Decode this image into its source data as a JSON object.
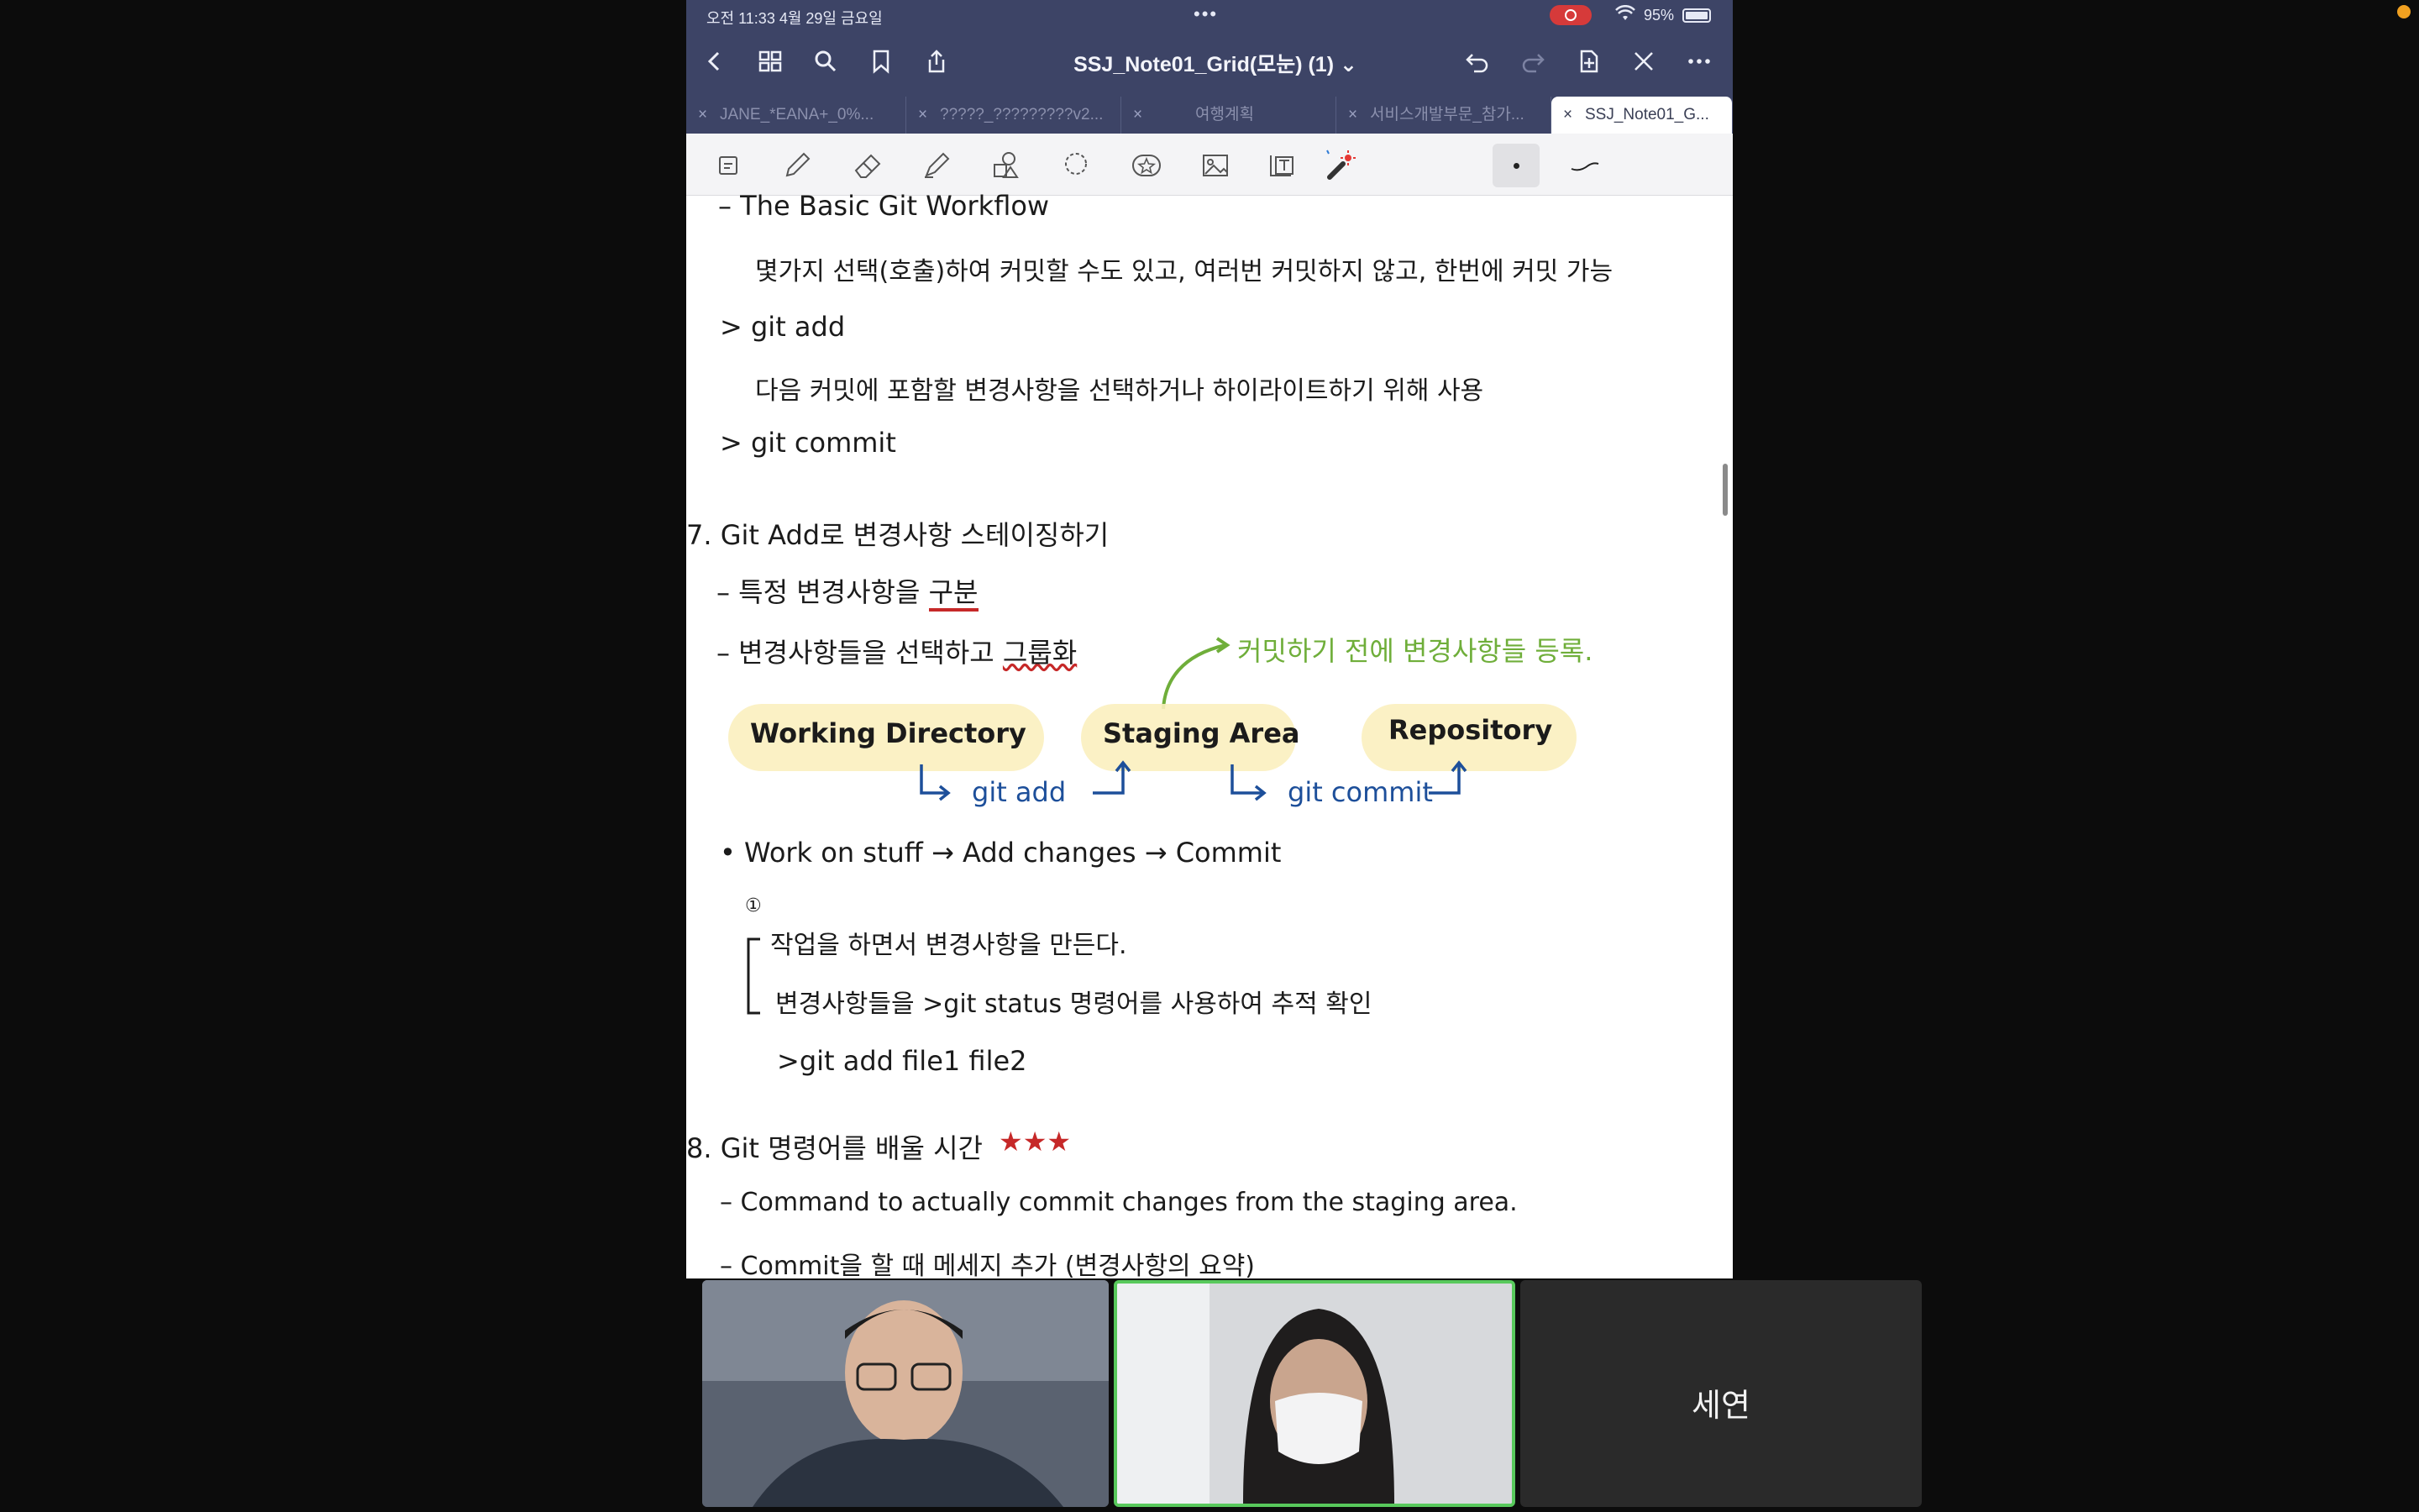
{
  "status_bar": {
    "time": "오전 11:33   4월 29일 금요일",
    "dots": "•••",
    "battery": "95%"
  },
  "nav": {
    "title": "SSJ_Note01_Grid(모눈) (1) ⌄"
  },
  "tabs": [
    {
      "label": "JANE_*EANA+_0%..."
    },
    {
      "label": "?????_?????????v2..."
    },
    {
      "label": "여행계획"
    },
    {
      "label": "서비스개발부문_참가..."
    },
    {
      "label": "SSJ_Note01_G..."
    }
  ],
  "note": {
    "line1": "– The Basic Git Workflow",
    "line2": "몇가지 선택(호출)하여 커밋할 수도 있고, 여러번 커밋하지 않고, 한번에 커밋 가능",
    "line3": "> git add",
    "line4": "다음 커밋에 포함할 변경사항을 선택하거나 하이라이트하기 위해 사용",
    "line5": "> git commit",
    "section7_title": "7. Git Add로 변경사항 스테이징하기",
    "bullet1_prefix": "– 특정 변경사항을 ",
    "bullet1_em": "구분",
    "bullet2_prefix": "– 변경사항들을 선택하고 ",
    "bullet2_em": "그룹화",
    "green_note": "커밋하기 전에 변경사항들 등록.",
    "box1": "Working Directory",
    "box2": "Staging Area",
    "box3": "Repository",
    "arrow1": "git add",
    "arrow2": "git commit",
    "flow": "• Work on stuff   →   Add changes   →   Commit",
    "step_marker": "①",
    "step1": "작업을 하면서 변경사항을 만든다.",
    "step2": "변경사항들을   >git status   명령어를 사용하여   추적 확인",
    "cmd": ">git add  file1  file2",
    "section8_title": "8. Git 명령어를 배울 시간",
    "stars": "★★★",
    "bullet3": "– Command to actually commit changes from the staging area.",
    "bullet4": "– Commit을 할 때 메세지 추가 (변경사항의 요약)"
  },
  "participants": [
    {
      "name": ""
    },
    {
      "name": ""
    },
    {
      "name": "세연"
    }
  ],
  "colors": {
    "nav_bg": "#3d4466",
    "highlight": "#fbf0bf",
    "blue_ink": "#1d4f9a",
    "green_ink": "#6fae3a",
    "active_speaker": "#58c95c"
  }
}
